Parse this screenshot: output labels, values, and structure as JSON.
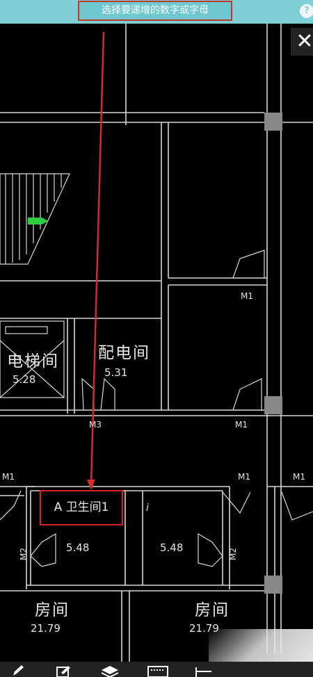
{
  "prompt_text": "选择要递增的数字或字母",
  "help_icon": "?",
  "close_icon": "✕",
  "selected_text": "A 卫生间1",
  "extra_glyph": "i",
  "rooms": [
    {
      "name": "电梯间",
      "area": "5.28"
    },
    {
      "name": "配电间",
      "area": "5.31"
    },
    {
      "name": "5.48",
      "area": "5.48"
    },
    {
      "name": "房间",
      "area": "21.79"
    },
    {
      "name": "房间",
      "area": "21.79"
    }
  ],
  "doors": {
    "m1": "M1",
    "m2": "M2",
    "m3": "M3"
  },
  "colors": {
    "background": "#000000",
    "topbar": "#7fd0d6",
    "highlight": "#e02020",
    "cad_lines": "#d8d8d8"
  },
  "toolbar": {
    "icons": [
      "pencil-icon",
      "edit-box-icon",
      "layers-icon",
      "keyboard-icon",
      "measure-icon"
    ]
  }
}
